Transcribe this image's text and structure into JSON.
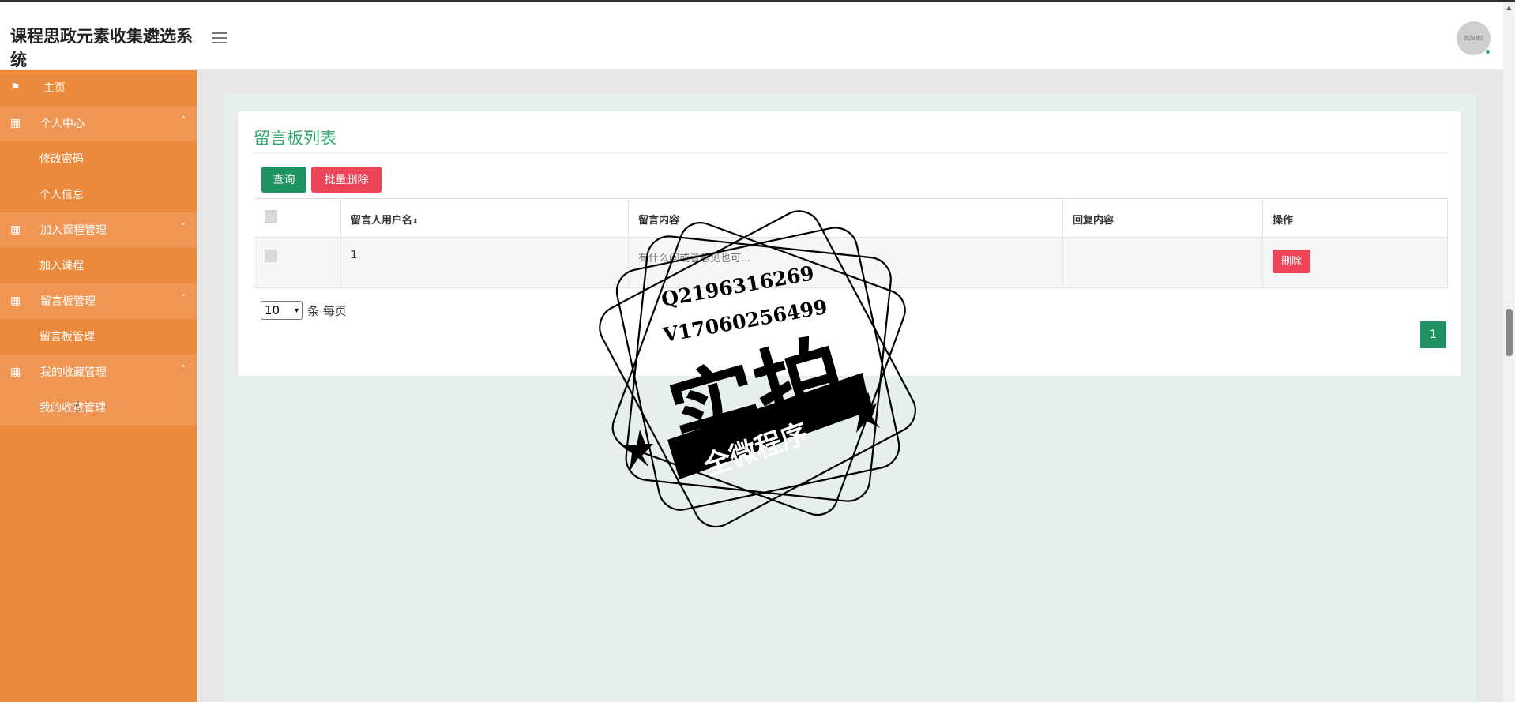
{
  "app": {
    "title": "课程思政元素收集遴选系统"
  },
  "header": {
    "avatar_text": "80x80",
    "menu_icon": "hamburger-icon"
  },
  "sidebar": {
    "items": [
      {
        "label": "主页",
        "type": "home",
        "icon": "flag-icon"
      },
      {
        "label": "个人中心",
        "type": "parent",
        "icon": "grid-icon"
      },
      {
        "label": "修改密码",
        "type": "sub"
      },
      {
        "label": "个人信息",
        "type": "sub"
      },
      {
        "label": "加入课程管理",
        "type": "parent",
        "icon": "grid-icon"
      },
      {
        "label": "加入课程",
        "type": "sub"
      },
      {
        "label": "留言板管理",
        "type": "parent",
        "icon": "grid-icon"
      },
      {
        "label": "留言板管理",
        "type": "sub"
      },
      {
        "label": "我的收藏管理",
        "type": "parent",
        "icon": "grid-icon"
      },
      {
        "label": "我的收藏管理",
        "type": "sub"
      }
    ]
  },
  "main": {
    "title": "留言板列表",
    "buttons": {
      "query": "查询",
      "batch_delete": "批量删除"
    },
    "table": {
      "columns": [
        "",
        "留言人用户名",
        "留言内容",
        "回复内容",
        "操作"
      ],
      "rows": [
        {
          "username": "1",
          "content": "有什么问或者意见也可...",
          "reply": "",
          "action": "删除"
        }
      ]
    },
    "pagination": {
      "page_size": "10",
      "page_size_label": "条 每页",
      "current_page": "1"
    }
  },
  "watermark": {
    "line1": "Q2196316269",
    "line2": "V17060256499",
    "big": "实拍",
    "ribbon": "全微程序"
  },
  "colors": {
    "sidebar": "#eb8a3c",
    "accent_green": "#1e9361",
    "danger": "#ee4457",
    "title_green": "#32a86a"
  }
}
